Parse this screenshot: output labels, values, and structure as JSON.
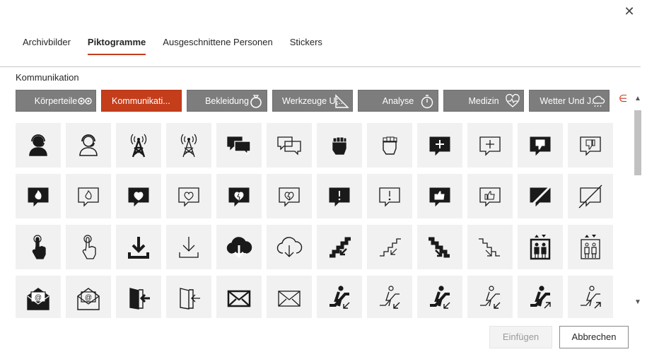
{
  "dialog": {
    "close_symbol": "✕"
  },
  "tabs": [
    {
      "label": "Archivbilder"
    },
    {
      "label": "Piktogramme"
    },
    {
      "label": "Ausgeschnittene Personen"
    },
    {
      "label": "Stickers"
    }
  ],
  "active_tab": "Piktogramme",
  "section_label": "Kommunikation",
  "categories": [
    {
      "label": "Körperteile",
      "icon": "eyes-icon"
    },
    {
      "label": "Kommunikati...",
      "icon": ""
    },
    {
      "label": "Bekleidung",
      "icon": "ring-icon"
    },
    {
      "label": "Werkzeuge U...",
      "icon": "ruler-triangle-icon"
    },
    {
      "label": "Analyse",
      "icon": "stopwatch-icon"
    },
    {
      "label": "Medizin",
      "icon": "heartbeat-icon"
    },
    {
      "label": "Wetter Und J...",
      "icon": "cloud-rain-icon"
    }
  ],
  "active_category": "Kommunikati...",
  "category_next_symbol": "∈",
  "icons": [
    [
      "headset-user-filled",
      "headset-user-outline",
      "radio-tower-filled",
      "radio-tower-outline",
      "chat-bubbles-filled",
      "chat-bubbles-outline",
      "fist-filled",
      "fist-outline",
      "add-comment-filled",
      "add-comment-outline",
      "thumbs-down-comment-filled",
      "thumbs-down-comment-outline"
    ],
    [
      "fire-comment-filled",
      "fire-comment-outline",
      "heart-comment-filled",
      "heart-comment-outline",
      "broken-heart-comment-filled",
      "broken-heart-comment-outline",
      "exclamation-comment-filled",
      "exclamation-comment-outline",
      "thumbs-up-comment-filled",
      "thumbs-up-comment-outline",
      "no-comment-filled",
      "no-comment-outline"
    ],
    [
      "tap-hand-filled",
      "tap-hand-outline",
      "download-filled",
      "download-outline",
      "cloud-download-filled",
      "cloud-download-outline",
      "stairs-down-filled",
      "stairs-down-outline",
      "stairs-down-right-filled",
      "stairs-down-right-outline",
      "elevator-filled",
      "elevator-outline"
    ],
    [
      "email-open-filled",
      "email-open-outline",
      "enter-door-filled",
      "enter-door-outline",
      "envelope-filled",
      "envelope-outline",
      "escalator-down-filled",
      "escalator-down-outline",
      "escalator-down-right-filled",
      "escalator-down-right-outline",
      "escalator-up-filled",
      "escalator-up-outline"
    ]
  ],
  "buttons": {
    "insert": "Einfügen",
    "cancel": "Abbrechen"
  },
  "scrollbar": {
    "up": "▲",
    "down": "▼"
  },
  "colors": {
    "accent": "#c43e1c",
    "category_bg": "#7d7d7d",
    "tile_bg": "#f1f1f1",
    "icon_fill": "#1a1a1a"
  }
}
